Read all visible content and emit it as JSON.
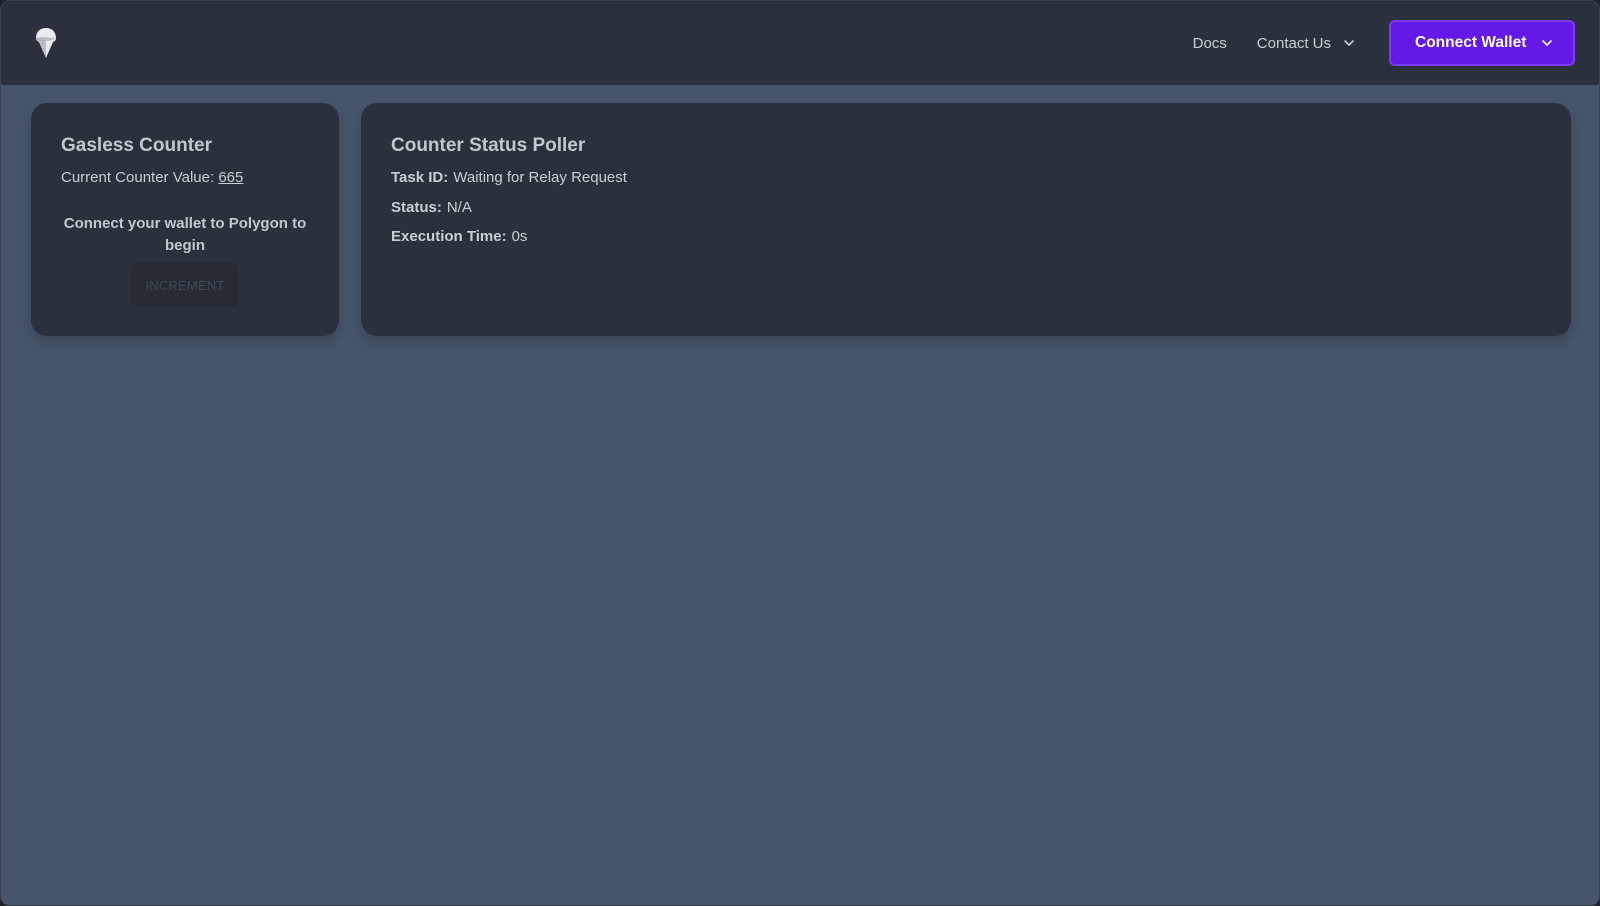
{
  "nav": {
    "logo": "gelato-logo-icon",
    "docs_label": "Docs",
    "contact_label": "Contact Us",
    "connect_wallet_label": "Connect Wallet"
  },
  "counter_card": {
    "title": "Gasless Counter",
    "current_value_label": "Current Counter Value:",
    "current_value": "665",
    "connect_message": "Connect your wallet to Polygon to begin",
    "increment_label": "INCREMENT"
  },
  "status_card": {
    "title": "Counter Status Poller",
    "task_id_label": "Task ID:",
    "task_id_value": "Waiting for Relay Request",
    "status_label": "Status:",
    "status_value": "N/A",
    "execution_time_label": "Execution Time:",
    "execution_time_value": "0s"
  },
  "colors": {
    "page_bg": "#475569",
    "navbar_bg": "#2a303c",
    "card_bg": "#2a303c",
    "primary": "#6419e6"
  }
}
